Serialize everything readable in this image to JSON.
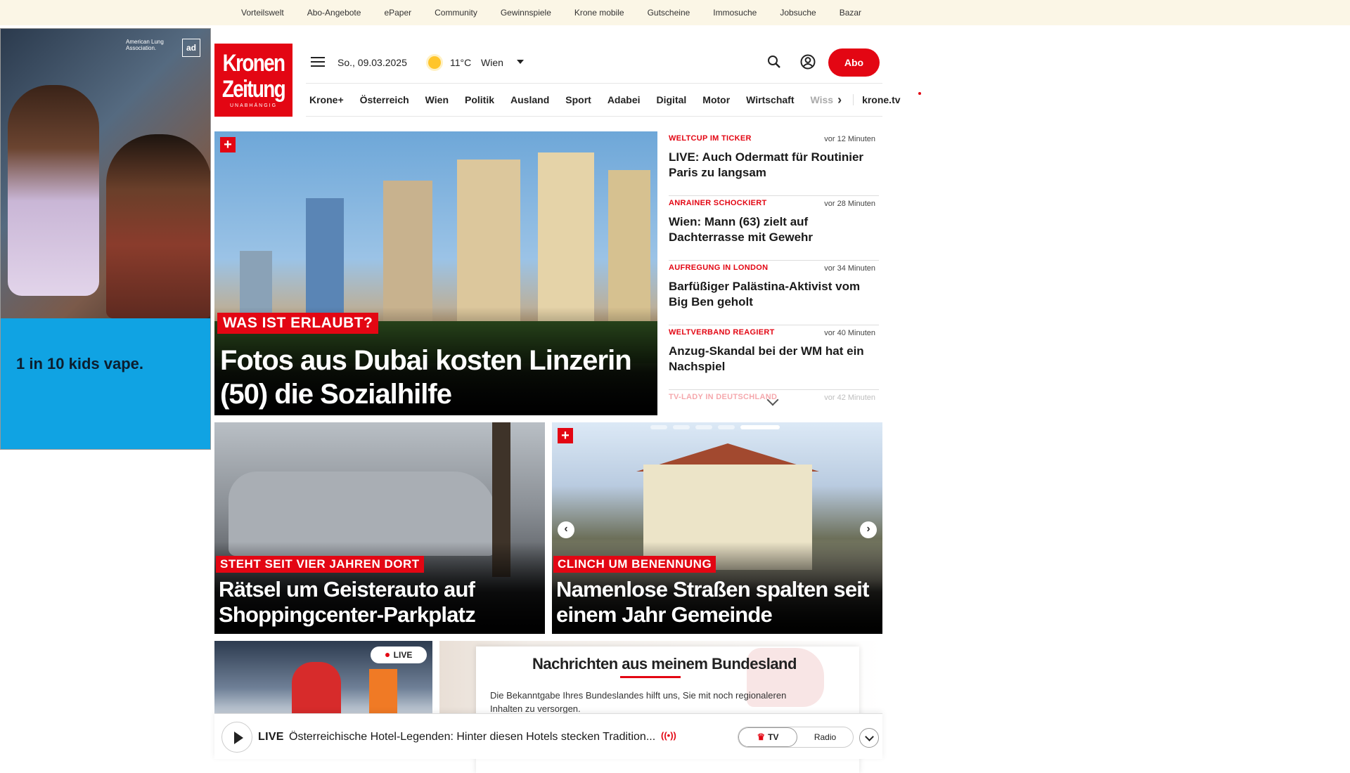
{
  "top_links": [
    "Vorteilswelt",
    "Abo-Angebote",
    "ePaper",
    "Community",
    "Gewinnspiele",
    "Krone mobile",
    "Gutscheine",
    "Immosuche",
    "Jobsuche",
    "Bazar"
  ],
  "ad": {
    "headline": "1 in 10 kids vape.",
    "logo_text": "American Lung Association.",
    "badge": "ad"
  },
  "header": {
    "logo_line1": "Kronen",
    "logo_line2": "Zeitung",
    "logo_sub": "UNABHÄNGIG",
    "date": "So., 09.03.2025",
    "temperature": "11°C",
    "city": "Wien",
    "abo_label": "Abo",
    "icons": [
      "menu-icon",
      "sun-icon",
      "search-icon",
      "user-icon"
    ]
  },
  "nav": {
    "items": [
      "Krone+",
      "Österreich",
      "Wien",
      "Politik",
      "Ausland",
      "Sport",
      "Adabei",
      "Digital",
      "Motor",
      "Wirtschaft"
    ],
    "truncated": "Wiss",
    "tv_label": "krone.tv"
  },
  "hero": {
    "kicker": "WAS IST ERLAUBT?",
    "title": "Fotos aus Dubai kosten Linzerin (50) die Sozialhilfe"
  },
  "ticker": [
    {
      "kicker": "WELTCUP IM TICKER",
      "time": "vor 12 Minuten",
      "title": "LIVE: Auch Odermatt für Routinier Paris zu langsam"
    },
    {
      "kicker": "ANRAINER SCHOCKIERT",
      "time": "vor 28 Minuten",
      "title": "Wien: Mann (63) zielt auf Dachterrasse mit Gewehr"
    },
    {
      "kicker": "AUFREGUNG IN LONDON",
      "time": "vor 34 Minuten",
      "title": "Barfüßiger Palästina-Aktivist vom Big Ben geholt"
    },
    {
      "kicker": "WELTVERBAND REAGIERT",
      "time": "vor 40 Minuten",
      "title": "Anzug-Skandal bei der WM hat ein Nachspiel"
    },
    {
      "kicker": "TV-LADY IN DEUTSCHLAND",
      "time": "vor 42 Minuten",
      "title": ""
    }
  ],
  "cards": [
    {
      "kicker": "STEHT SEIT VIER JAHREN DORT",
      "title": "Rätsel um Geisterauto auf Shoppingcenter-Parkplatz"
    },
    {
      "kicker": "CLINCH UM BENENNUNG",
      "title": "Namenlose Straßen spalten seit einem Jahr Gemeinde"
    }
  ],
  "carousel": {
    "slides": 5,
    "active_index": 4
  },
  "live_badge": "LIVE",
  "popup": {
    "title": "Nachrichten aus meinem Bundesland",
    "text": "Die Bekanntgabe Ihres Bundeslandes hilft uns, Sie mit noch regionaleren Inhalten zu versorgen."
  },
  "player": {
    "live_label": "LIVE",
    "text": "Österreichische Hotel-Legenden: Hinter diesen Hotels stecken Tradition...",
    "broadcast_icon": "((•))",
    "tv_label": "TV",
    "radio_label": "Radio"
  },
  "colors": {
    "brand_red": "#e30613",
    "topbar_bg": "#fbf6e6",
    "ad_blue": "#10a3e3"
  }
}
